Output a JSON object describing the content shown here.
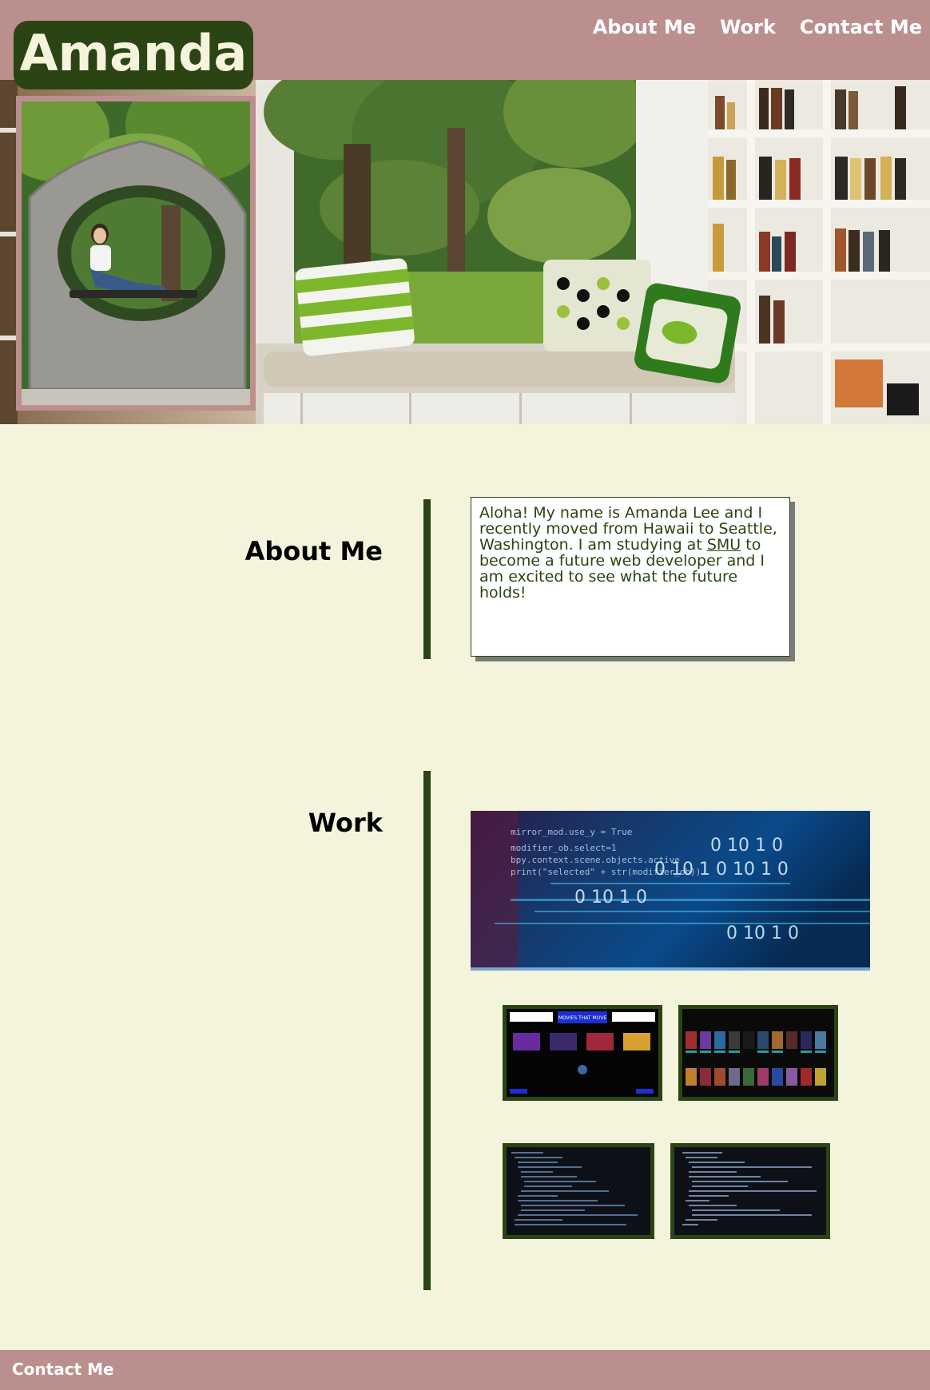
{
  "header": {
    "brand_name": "Amanda",
    "nav": [
      {
        "label": "About Me"
      },
      {
        "label": "Work"
      },
      {
        "label": "Contact Me"
      }
    ]
  },
  "about": {
    "heading": "About Me",
    "text_before_link": "Aloha! My name is Amanda Lee and I recently moved from Hawaii to Seattle, Washington. I am studying at ",
    "link_text": "SMU",
    "text_after_link": " to become a future web developer and I am excited to see what the future holds!"
  },
  "work": {
    "heading": "Work",
    "thumb1_title": "MOVIES THAT MOVE"
  },
  "footer": {
    "title": "Contact Me"
  },
  "colors": {
    "header_bg": "#bc8f8f",
    "page_bg": "#f4f4dc",
    "accent_green": "#2b4414",
    "link_text": "#ffffff"
  }
}
